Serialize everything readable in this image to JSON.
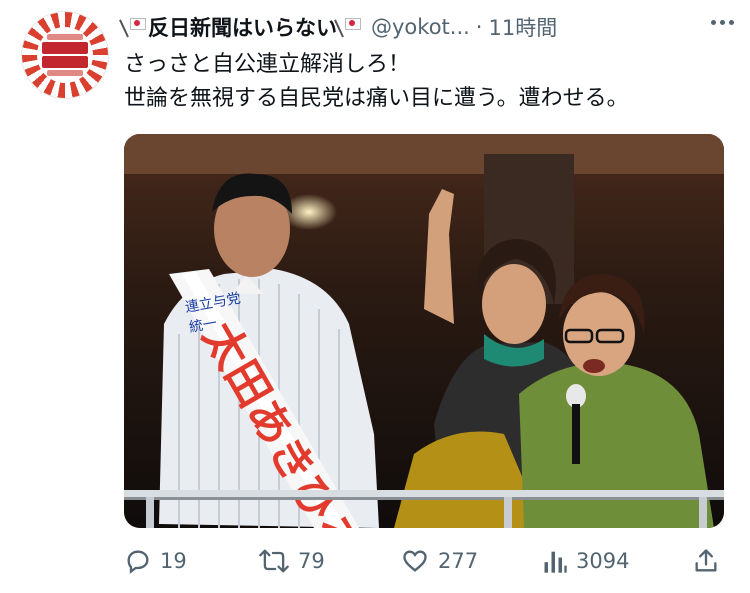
{
  "tweet": {
    "display_name": "反日新聞はいらない",
    "handle": "@yokot...",
    "separator": "·",
    "time": "11時間",
    "text_lines": [
      "さっさと自公連立解消しろ！",
      "世論を無視する自民党は痛い目に遭う。遭わせる。"
    ]
  },
  "media": {
    "sash_lines": [
      "連立与党",
      "統一",
      "太田あきひろ"
    ]
  },
  "actions": {
    "reply_count": "19",
    "retweet_count": "79",
    "like_count": "277",
    "views_count": "3094"
  },
  "icons": [
    "flag-icon",
    "more-icon",
    "reply-icon",
    "retweet-icon",
    "like-icon",
    "views-icon",
    "share-icon"
  ]
}
